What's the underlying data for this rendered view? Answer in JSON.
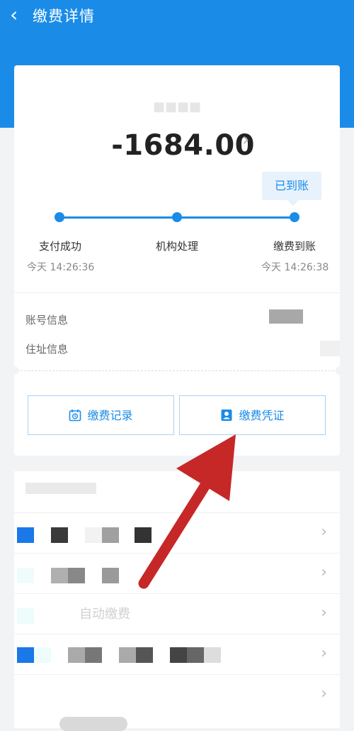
{
  "header": {
    "title": "缴费详情",
    "back_icon": "chevron-left-icon"
  },
  "payment": {
    "amount": "-1684.00",
    "status_badge": "已到账",
    "steps": [
      {
        "label": "支付成功",
        "time": "今天 14:26:36"
      },
      {
        "label": "机构处理",
        "time": ""
      },
      {
        "label": "缴费到账",
        "time": "今天 14:26:38"
      }
    ]
  },
  "info": {
    "account_label": "账号信息",
    "address_label": "住址信息"
  },
  "actions": {
    "records": "缴费记录",
    "receipt": "缴费凭证"
  },
  "list": {
    "row3_text": "自动缴费"
  },
  "colors": {
    "brand": "#1a8ce8",
    "annotation_arrow": "#c62828"
  }
}
